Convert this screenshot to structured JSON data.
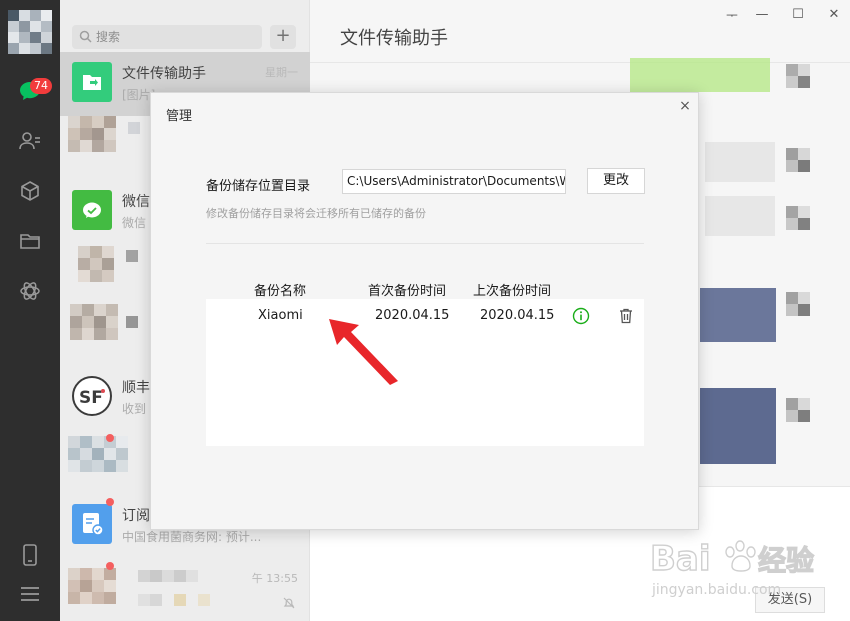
{
  "nav": {
    "unread_badge": "74"
  },
  "search": {
    "placeholder": "搜索",
    "add_label": "+"
  },
  "sessions": [
    {
      "name": "文件传输助手",
      "preview": "[图片]",
      "time": "星期一"
    },
    {
      "name": "微信",
      "preview": "微信"
    },
    {
      "name": "顺丰",
      "preview": "收到"
    },
    {
      "name": "订阅",
      "preview": "中国食用菌商务网: 预计..."
    },
    {
      "time": "午 13:55"
    }
  ],
  "chat": {
    "title": "文件传输助手",
    "send_label": "发送(S)"
  },
  "window_controls": {
    "pin": "ᅮ",
    "minimize": "—",
    "maximize": "☐",
    "close": "✕"
  },
  "modal": {
    "title": "管理",
    "close": "×",
    "path_label": "备份储存位置目录",
    "path_value": "C:\\Users\\Administrator\\Documents\\W",
    "change_label": "更改",
    "hint": "修改备份储存目录将会迁移所有已储存的备份",
    "columns": {
      "name": "备份名称",
      "first": "首次备份时间",
      "last": "上次备份时间"
    },
    "rows": [
      {
        "name": "Xiaomi",
        "first": "2020.04.15",
        "last": "2020.04.15"
      }
    ]
  },
  "watermark": {
    "brand": "Bai",
    "brand2": "经验",
    "url": "jingyan.baidu.com"
  },
  "colors": {
    "accent_green": "#07c160",
    "badge_red": "#f23c3c",
    "arrow_red": "#e8262a",
    "info_green": "#1aad19"
  }
}
